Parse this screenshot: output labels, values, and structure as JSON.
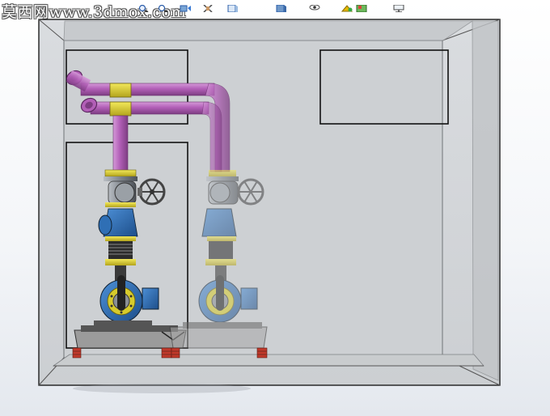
{
  "watermark": {
    "text": "莫西网www.3dmox.com"
  },
  "toolbar": {
    "icons": [
      "zoom-to-fit-icon",
      "zoom-area-icon",
      "previous-view-icon",
      "section-view-icon",
      "view-orientation-icon",
      "display-style-icon",
      "hide-show-items-icon",
      "edit-appearance-icon",
      "apply-scene-icon",
      "view-settings-icon"
    ]
  },
  "model": {
    "name": "pump-skid-assembly",
    "colors": {
      "pipe": "#b25fb7",
      "fitting": "#d7cb2c",
      "pump_body": "#2f6fb5",
      "valve": "#8a8f96",
      "frame": "#3a3a3a",
      "base": "#9b9b9b",
      "feet": "#c0392b"
    }
  }
}
